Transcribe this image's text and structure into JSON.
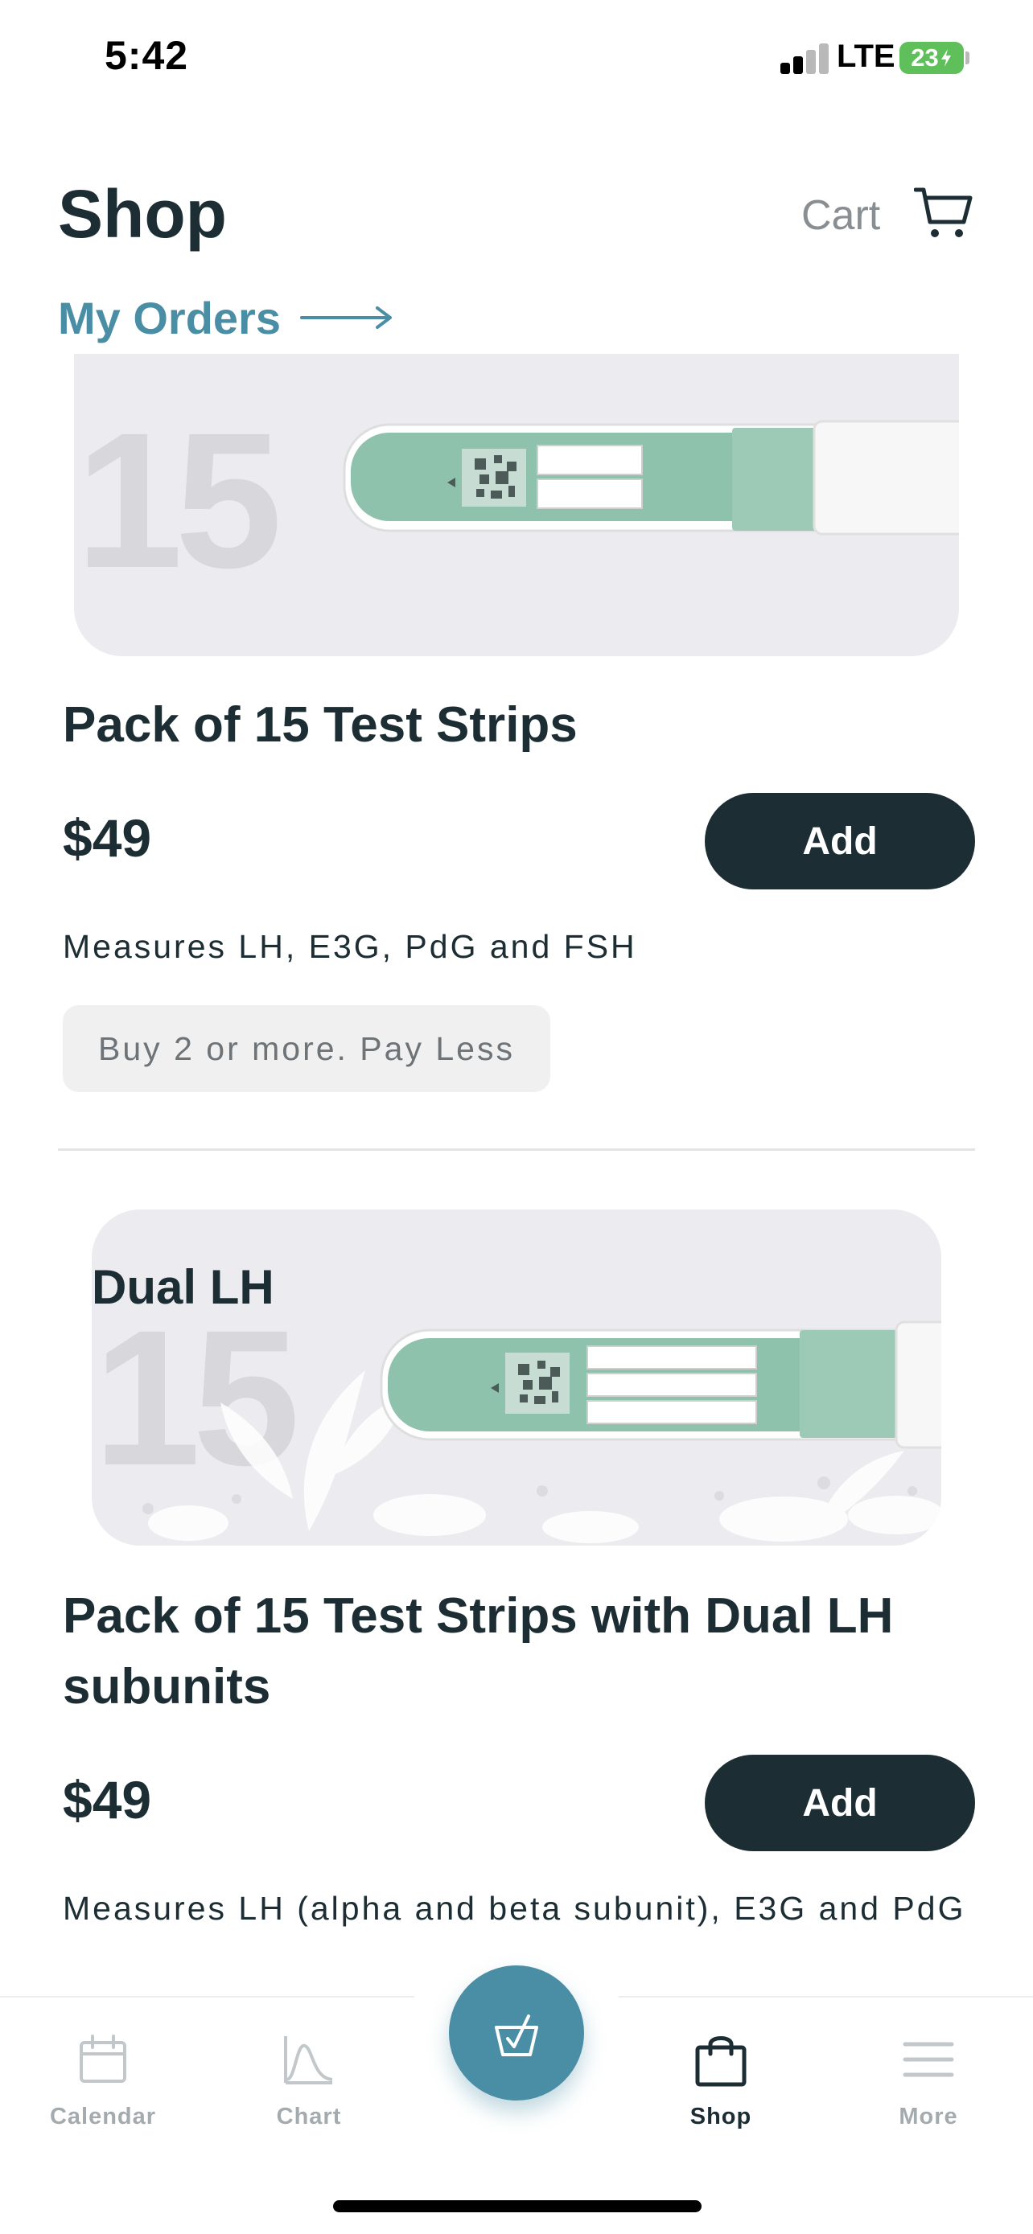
{
  "status_bar": {
    "time": "5:42",
    "network": "LTE",
    "battery": "23"
  },
  "header": {
    "title": "Shop",
    "cart_label": "Cart",
    "my_orders_label": "My Orders"
  },
  "products": [
    {
      "image_number": "15",
      "image_label": "",
      "title": "Pack of 15 Test Strips",
      "price": "$49",
      "add_label": "Add",
      "description": "Measures LH, E3G, PdG and FSH",
      "promo": "Buy 2 or more. Pay Less"
    },
    {
      "image_number": "15",
      "image_label": "Dual LH",
      "title": "Pack of 15 Test Strips with Dual LH subunits",
      "price": "$49",
      "add_label": "Add",
      "description": "Measures LH (alpha and beta subunit), E3G and PdG"
    }
  ],
  "tab_bar": {
    "items": [
      {
        "label": "Calendar",
        "icon": "calendar-icon",
        "active": false
      },
      {
        "label": "Chart",
        "icon": "chart-icon",
        "active": false
      },
      {
        "label": "",
        "icon": "check-test-icon",
        "active": false
      },
      {
        "label": "Shop",
        "icon": "shopping-bag-icon",
        "active": true
      },
      {
        "label": "More",
        "icon": "menu-icon",
        "active": false
      }
    ]
  },
  "colors": {
    "accent": "#4a8ea6",
    "dark": "#1c2d33",
    "muted": "#a4abae",
    "card_bg": "#ecebf0",
    "strip_green": "#8fc2ad"
  }
}
